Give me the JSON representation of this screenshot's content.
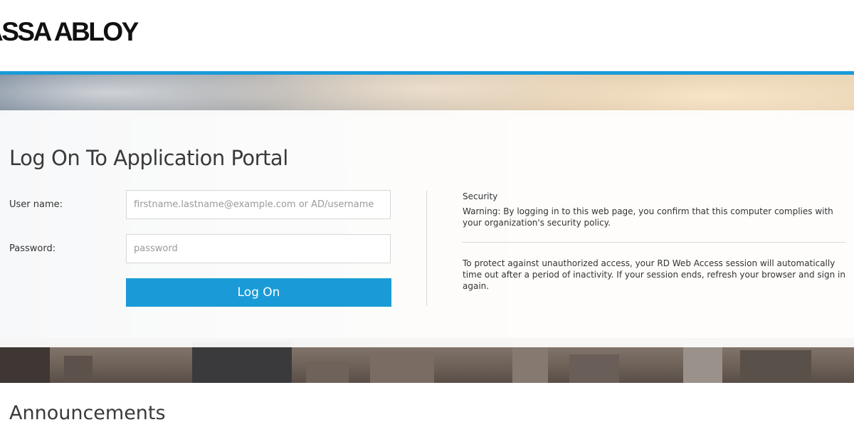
{
  "header": {
    "logo_text": "ASSA ABLOY"
  },
  "colors": {
    "accent": "#1a9bd7",
    "text": "#333333",
    "button_text": "#ffffff"
  },
  "login": {
    "title": "Log On To Application Portal",
    "username_label": "User name:",
    "username_placeholder": "firstname.lastname@example.com or AD/username",
    "username_value": "",
    "password_label": "Password:",
    "password_placeholder": "password",
    "password_value": "",
    "submit_label": "Log On"
  },
  "security": {
    "heading": "Security",
    "warning": "Warning: By logging in to this web page, you confirm that this computer complies with your organization's security policy.",
    "timeout_notice": "To protect against unauthorized access, your RD Web Access session will automatically time out after a period of inactivity. If your session ends, refresh your browser and sign in again."
  },
  "announcements": {
    "title": "Announcements"
  }
}
